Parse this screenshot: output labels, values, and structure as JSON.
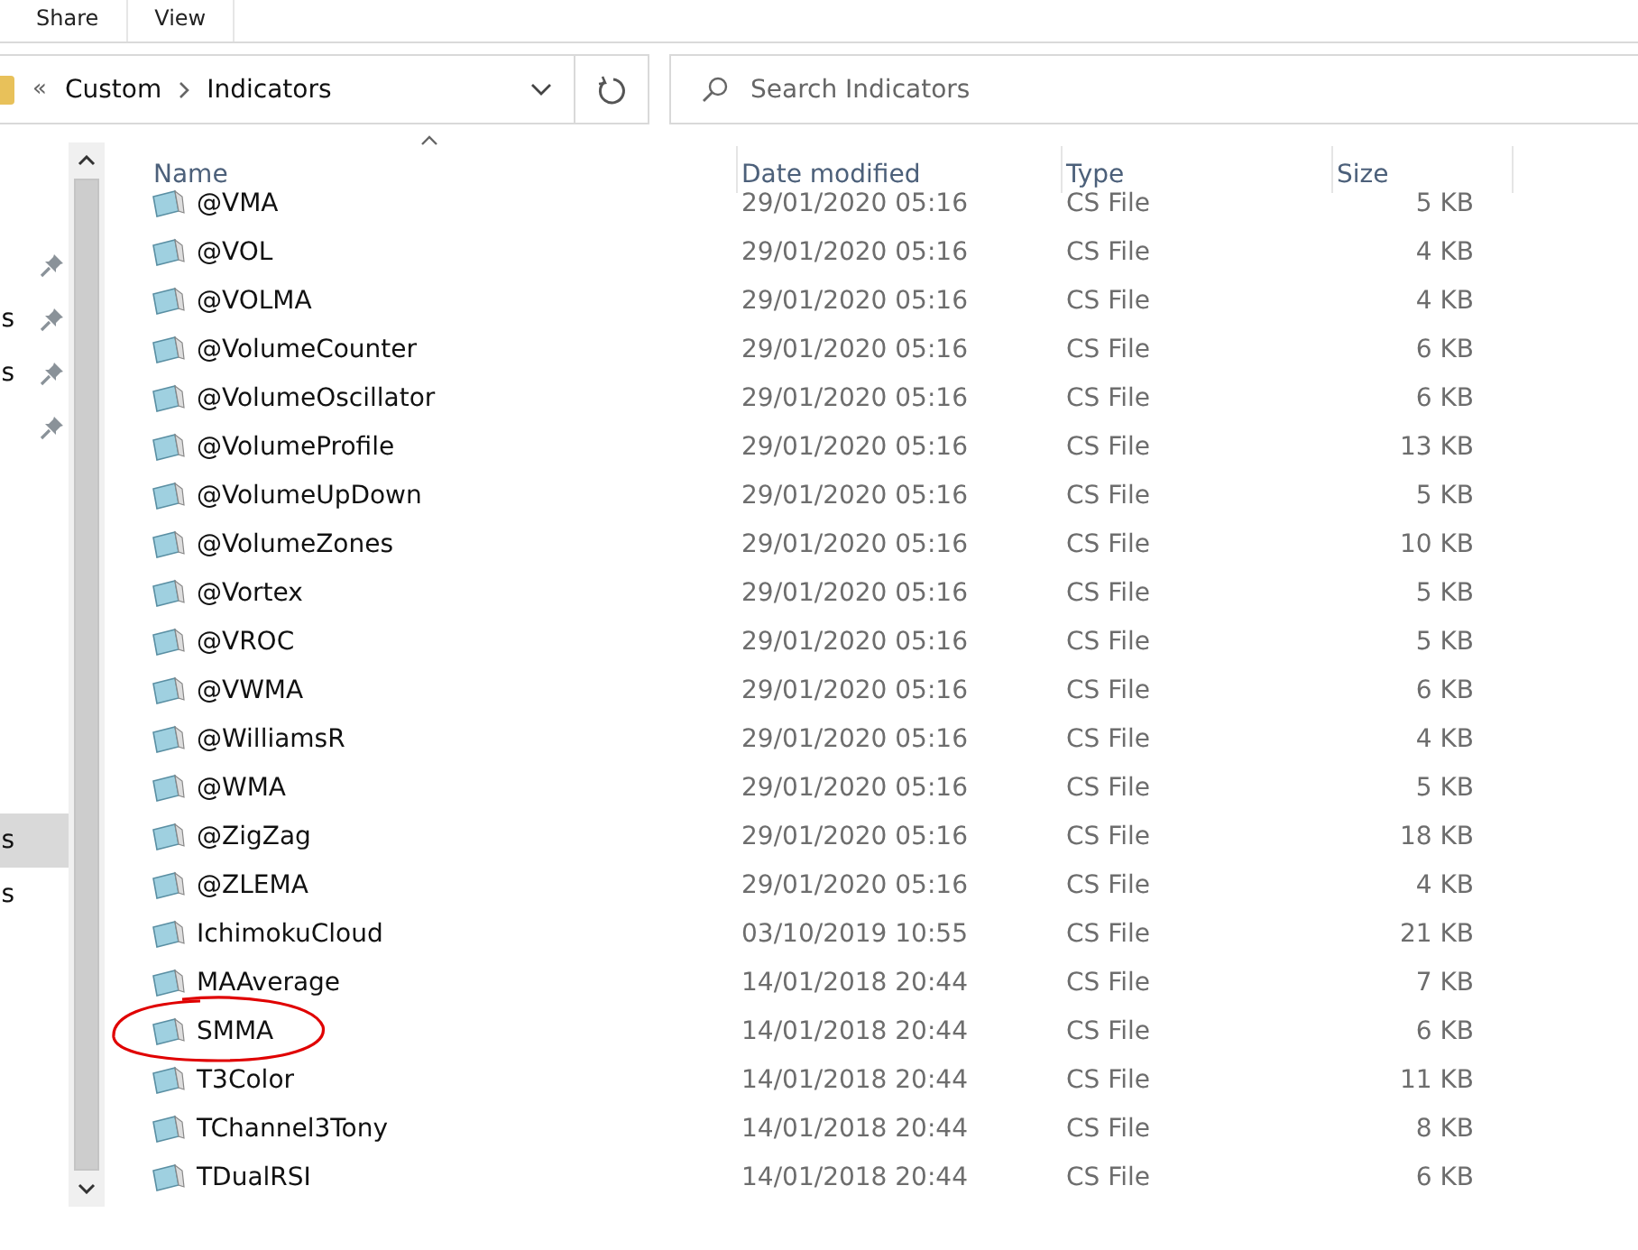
{
  "ribbon": {
    "tabs": [
      "Share",
      "View"
    ]
  },
  "address_bar": {
    "overflow": "«",
    "path": [
      "Custom",
      "Indicators"
    ]
  },
  "search": {
    "placeholder": "Search Indicators"
  },
  "sidebar": {
    "items": [
      {
        "pinned": true,
        "selected": false
      },
      {
        "label": "s",
        "pinned": true,
        "selected": false
      },
      {
        "label": "s",
        "pinned": true,
        "selected": false
      },
      {
        "pinned": true,
        "selected": false
      },
      {
        "label": "s",
        "pinned": false,
        "selected": true
      },
      {
        "label": "s",
        "pinned": false,
        "selected": false
      }
    ]
  },
  "table": {
    "columns": [
      "Name",
      "Date modified",
      "Type",
      "Size"
    ],
    "rows": [
      {
        "name": "@VMA",
        "date": "29/01/2020 05:16",
        "type": "CS File",
        "size": "5 KB",
        "circled": false
      },
      {
        "name": "@VOL",
        "date": "29/01/2020 05:16",
        "type": "CS File",
        "size": "4 KB",
        "circled": false
      },
      {
        "name": "@VOLMA",
        "date": "29/01/2020 05:16",
        "type": "CS File",
        "size": "4 KB",
        "circled": false
      },
      {
        "name": "@VolumeCounter",
        "date": "29/01/2020 05:16",
        "type": "CS File",
        "size": "6 KB",
        "circled": false
      },
      {
        "name": "@VolumeOscillator",
        "date": "29/01/2020 05:16",
        "type": "CS File",
        "size": "6 KB",
        "circled": false
      },
      {
        "name": "@VolumeProfile",
        "date": "29/01/2020 05:16",
        "type": "CS File",
        "size": "13 KB",
        "circled": false
      },
      {
        "name": "@VolumeUpDown",
        "date": "29/01/2020 05:16",
        "type": "CS File",
        "size": "5 KB",
        "circled": false
      },
      {
        "name": "@VolumeZones",
        "date": "29/01/2020 05:16",
        "type": "CS File",
        "size": "10 KB",
        "circled": false
      },
      {
        "name": "@Vortex",
        "date": "29/01/2020 05:16",
        "type": "CS File",
        "size": "5 KB",
        "circled": false
      },
      {
        "name": "@VROC",
        "date": "29/01/2020 05:16",
        "type": "CS File",
        "size": "5 KB",
        "circled": false
      },
      {
        "name": "@VWMA",
        "date": "29/01/2020 05:16",
        "type": "CS File",
        "size": "6 KB",
        "circled": false
      },
      {
        "name": "@WilliamsR",
        "date": "29/01/2020 05:16",
        "type": "CS File",
        "size": "4 KB",
        "circled": false
      },
      {
        "name": "@WMA",
        "date": "29/01/2020 05:16",
        "type": "CS File",
        "size": "5 KB",
        "circled": false
      },
      {
        "name": "@ZigZag",
        "date": "29/01/2020 05:16",
        "type": "CS File",
        "size": "18 KB",
        "circled": false
      },
      {
        "name": "@ZLEMA",
        "date": "29/01/2020 05:16",
        "type": "CS File",
        "size": "4 KB",
        "circled": false
      },
      {
        "name": "IchimokuCloud",
        "date": "03/10/2019 10:55",
        "type": "CS File",
        "size": "21 KB",
        "circled": false
      },
      {
        "name": "MAAverage",
        "date": "14/01/2018 20:44",
        "type": "CS File",
        "size": "7 KB",
        "circled": false
      },
      {
        "name": "SMMA",
        "date": "14/01/2018 20:44",
        "type": "CS File",
        "size": "6 KB",
        "circled": true
      },
      {
        "name": "T3Color",
        "date": "14/01/2018 20:44",
        "type": "CS File",
        "size": "11 KB",
        "circled": false
      },
      {
        "name": "TChannel3Tony",
        "date": "14/01/2018 20:44",
        "type": "CS File",
        "size": "8 KB",
        "circled": false
      },
      {
        "name": "TDualRSI",
        "date": "14/01/2018 20:44",
        "type": "CS File",
        "size": "6 KB",
        "circled": false
      }
    ]
  }
}
